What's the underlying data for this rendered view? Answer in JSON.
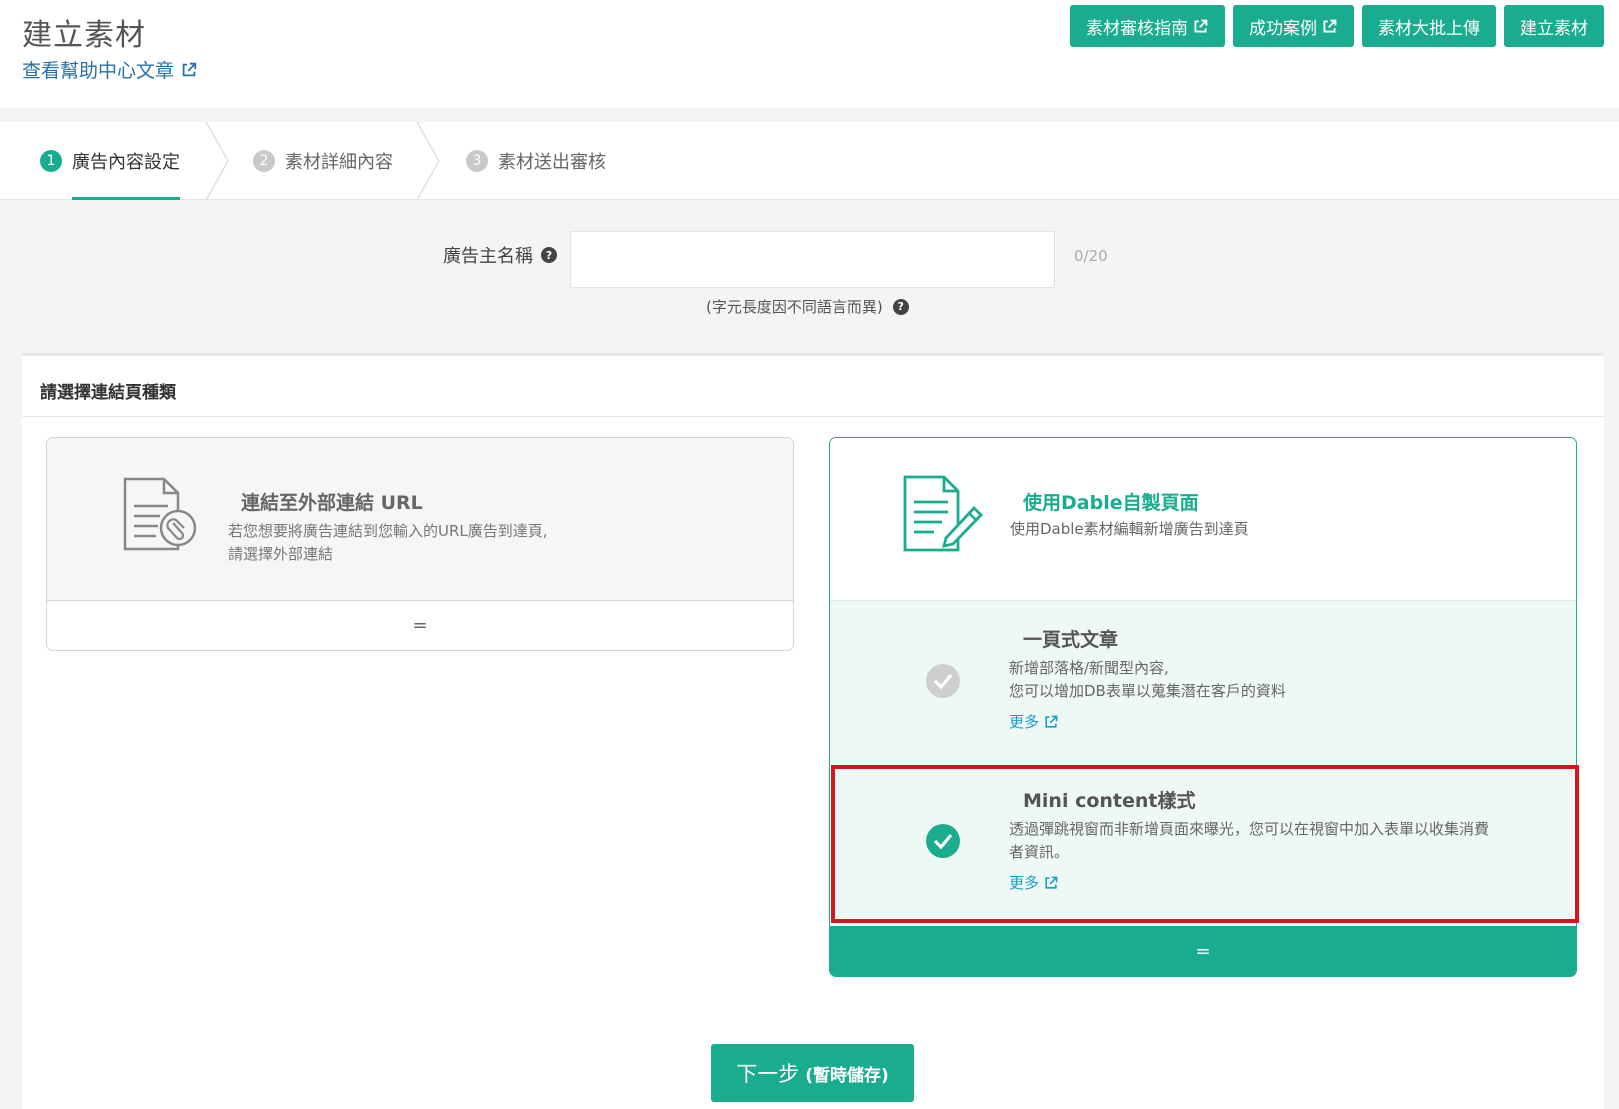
{
  "header": {
    "title": "建立素材",
    "help_link": "查看幫助中心文章",
    "buttons": [
      {
        "label": "素材審核指南",
        "external": true
      },
      {
        "label": "成功案例",
        "external": true
      },
      {
        "label": "素材大批上傳",
        "external": false
      },
      {
        "label": "建立素材",
        "external": false
      }
    ]
  },
  "steps": [
    {
      "num": "1",
      "label": "廣告內容設定",
      "active": true
    },
    {
      "num": "2",
      "label": "素材詳細內容",
      "active": false
    },
    {
      "num": "3",
      "label": "素材送出審核",
      "active": false
    }
  ],
  "advertiser": {
    "label": "廣告主名稱",
    "value": "",
    "count": "0/20",
    "hint": "(字元長度因不同語言而異)"
  },
  "section": {
    "title": "請選擇連結頁種類",
    "external_card": {
      "title": "連結至外部連結 URL",
      "desc_line1": "若您想要將廣告連結到您輸入的URL廣告到達頁,",
      "desc_line2": "請選擇外部連結",
      "footer": "="
    },
    "dable_card": {
      "title": "使用Dable自製頁面",
      "desc": "使用Dable素材編輯新增廣告到達頁",
      "options": [
        {
          "title": "一頁式文章",
          "desc_line1": "新增部落格/新聞型內容,",
          "desc_line2": "您可以增加DB表單以蒐集潛在客戶的資料",
          "more": "更多",
          "selected": false
        },
        {
          "title": "Mini content樣式",
          "desc_line1": "透過彈跳視窗而非新增頁面來曝光，您可以在視窗中加入表單以收集消費",
          "desc_line2": "者資訊。",
          "more": "更多",
          "selected": true
        }
      ],
      "footer": "="
    }
  },
  "next_button": {
    "main": "下一步",
    "sub": "(暫時儲存)"
  },
  "colors": {
    "accent": "#1aac8e",
    "highlight": "#d4161e",
    "link": "#2a6fa8"
  }
}
